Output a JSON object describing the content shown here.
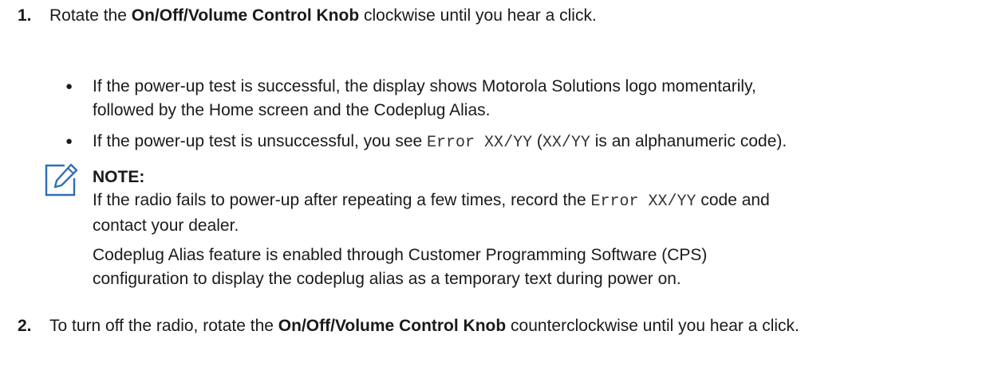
{
  "step1": {
    "number": "1.",
    "prefix": "Rotate the ",
    "bold": "On/Off/Volume Control Knob",
    "suffix": " clockwise until you hear a click."
  },
  "bullets": [
    {
      "line1": "If the power-up test is successful, the display shows Motorola Solutions logo momentarily,",
      "line2": "followed by the Home screen and the Codeplug Alias."
    },
    {
      "prefix": "If the power-up test is unsuccessful, you see ",
      "code1": "Error XX/YY",
      "middle": " (",
      "code2": "XX/YY",
      "suffix": " is an alphanumeric code)."
    }
  ],
  "note": {
    "icon": "pencil-note-icon",
    "title": "NOTE:",
    "para1_prefix": "If the radio fails to power-up after repeating a few times, record the ",
    "para1_code": "Error XX/YY",
    "para1_suffix": " code and",
    "para1_line2": "contact your dealer.",
    "para2_line1": "Codeplug Alias feature is enabled through Customer Programming Software (CPS)",
    "para2_line2": "configuration to display the codeplug alias as a temporary text during power on."
  },
  "step2": {
    "number": "2.",
    "prefix": "To turn off the radio, rotate the ",
    "bold": "On/Off/Volume Control Knob",
    "suffix": " counterclockwise until you hear a click."
  },
  "colors": {
    "text": "#1a1a1a",
    "icon": "#2f6fb6"
  }
}
